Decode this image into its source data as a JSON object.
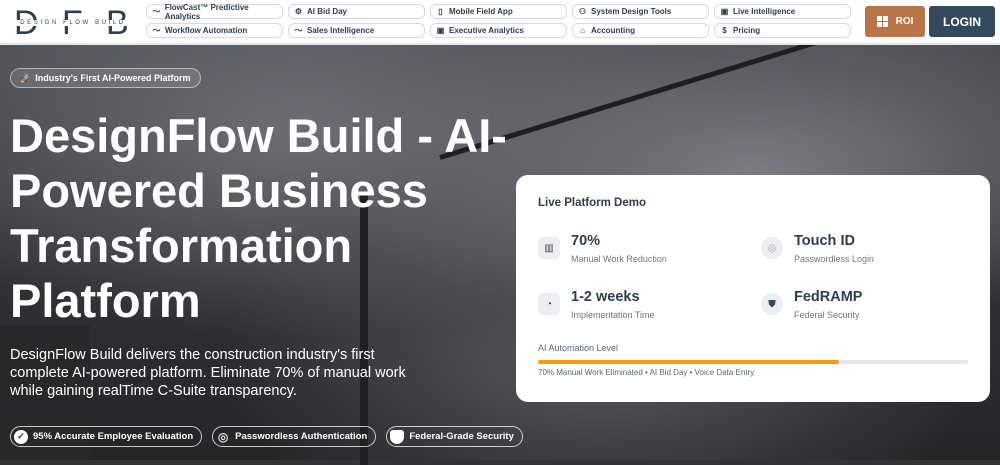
{
  "brand": {
    "letters": [
      "D",
      "F",
      "B"
    ],
    "tagline": "DESIGN FLOW BUILD"
  },
  "nav": [
    {
      "icon": "trend-icon",
      "glyph": "〜",
      "label": "FlowCast™ Predictive Analytics"
    },
    {
      "icon": "robot-icon",
      "glyph": "⚙",
      "label": "AI Bid Day"
    },
    {
      "icon": "mobile-icon",
      "glyph": "▯",
      "label": "Mobile Field App"
    },
    {
      "icon": "users-cog-icon",
      "glyph": "⚇",
      "label": "System Design Tools"
    },
    {
      "icon": "chart-icon",
      "glyph": "▣",
      "label": "Live Intelligence"
    },
    {
      "icon": "trend-icon",
      "glyph": "〜",
      "label": "Workflow Automation"
    },
    {
      "icon": "trend-icon",
      "glyph": "〜",
      "label": "Sales Intelligence"
    },
    {
      "icon": "chart-icon",
      "glyph": "▣",
      "label": "Executive Analytics"
    },
    {
      "icon": "bank-icon",
      "glyph": "⌂",
      "label": "Accounting"
    },
    {
      "icon": "dollar-icon",
      "glyph": "$",
      "label": "Pricing"
    }
  ],
  "roi_label": "ROI",
  "login_label": "LOGIN",
  "hero": {
    "badge": "Industry's First AI-Powered Platform",
    "title": "DesignFlow Build - AI-Powered Business Transformation Platform",
    "description": "DesignFlow Build delivers the construction industry's first complete AI-powered platform. Eliminate 70% of manual work while gaining realTime C-Suite transparency.",
    "features": [
      "95% Accurate Employee Evaluation",
      "Passwordless Authentication",
      "Federal-Grade Security"
    ]
  },
  "demo": {
    "title": "Live Platform Demo",
    "stats": [
      {
        "value": "70%",
        "label": "Manual Work Reduction"
      },
      {
        "value": "Touch ID",
        "label": "Passwordless Login"
      },
      {
        "value": "1-2 weeks",
        "label": "Implementation Time"
      },
      {
        "value": "FedRAMP",
        "label": "Federal Security"
      }
    ],
    "automation_label": "AI Automation Level",
    "automation_percent": 70,
    "note": "70% Manual Work Eliminated • AI Bid Day • Voice Data Entry"
  }
}
